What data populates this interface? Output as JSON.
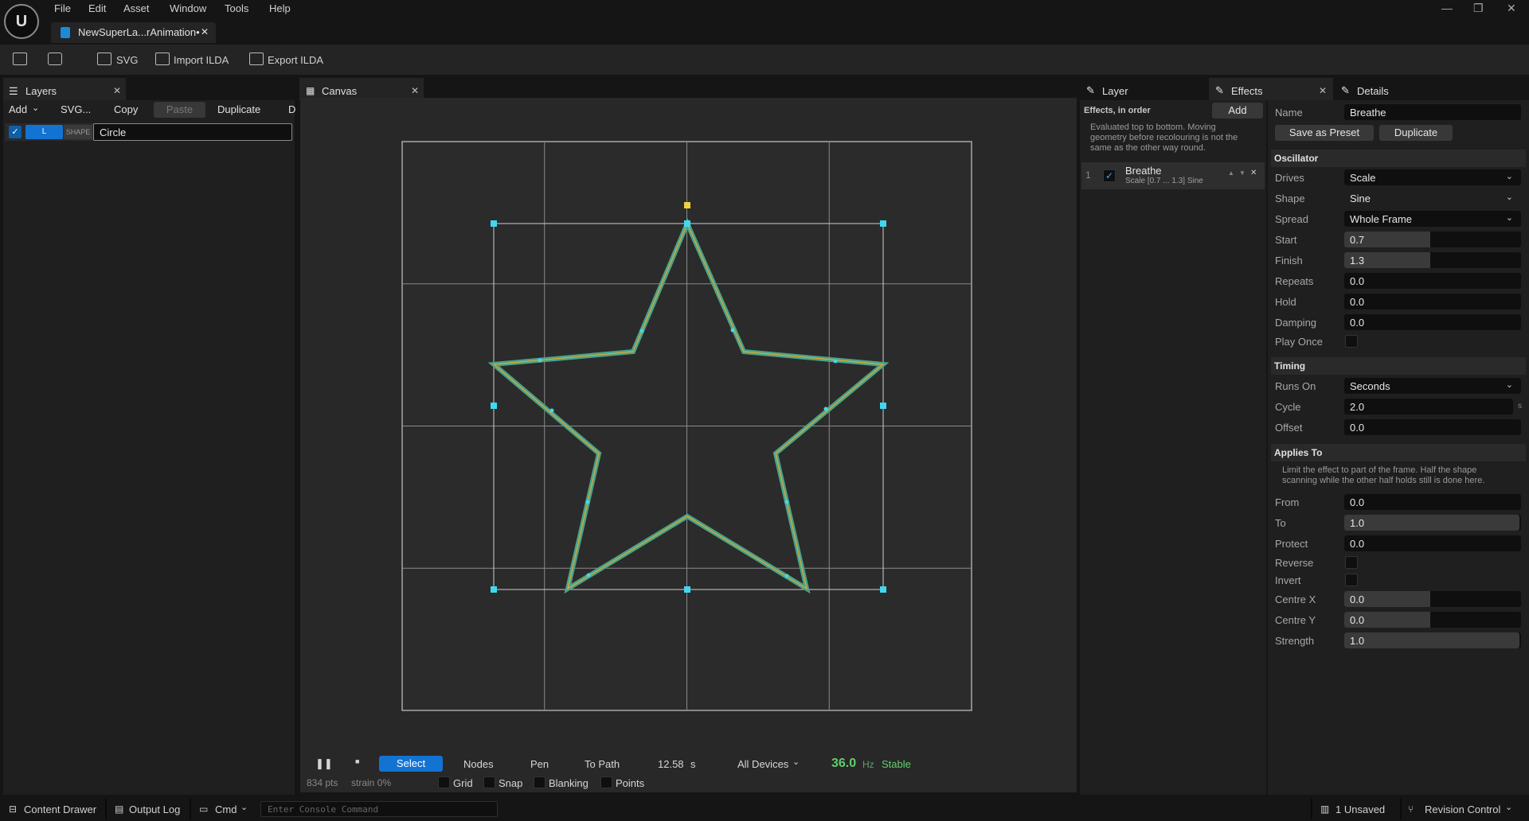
{
  "app": {
    "logo": "U",
    "doc_tab": "NewSuperLa...rAnimation•"
  },
  "menu": [
    "File",
    "Edit",
    "Asset",
    "Window",
    "Tools",
    "Help"
  ],
  "toolbar": {
    "svg": "SVG",
    "import_ilda": "Import ILDA",
    "export_ilda": "Export ILDA"
  },
  "layers": {
    "tab": "Layers",
    "add": "Add",
    "svg": "SVG...",
    "copy": "Copy",
    "paste": "Paste",
    "duplicate": "Duplicate",
    "more": "D",
    "row": {
      "badge": "L",
      "type": "SHAPE",
      "name": "Circle"
    }
  },
  "canvas": {
    "tab": "Canvas",
    "select": "Select",
    "nodes": "Nodes",
    "pen": "Pen",
    "to_path": "To Path",
    "time": "12.58",
    "time_unit": "s",
    "devices": "All Devices",
    "hz_value": "36.0",
    "hz_unit": "Hz",
    "stable": "Stable",
    "pts": "834 pts",
    "strain": "strain 0%",
    "grid": "Grid",
    "snap": "Snap",
    "blanking": "Blanking",
    "points": "Points",
    "colors": {
      "stroke_outer": "#4aa38a",
      "stroke_inner": "#e0a830",
      "handle": "#40d8f0",
      "pivot": "#f0d040"
    }
  },
  "effects": {
    "tab_layer": "Layer",
    "tab_effects": "Effects",
    "tab_details": "Details",
    "header": "Effects, in order",
    "add": "Add",
    "note": [
      "Evaluated top to bottom. Moving",
      "geometry before recolouring is not the",
      "same as the other way round."
    ],
    "item": {
      "index": "1",
      "name": "Breathe",
      "desc": "Scale  [0.7 ... 1.3]  Sine"
    }
  },
  "details": {
    "name_label": "Name",
    "name_value": "Breathe",
    "save_preset": "Save as Preset",
    "duplicate": "Duplicate",
    "oscillator": "Oscillator",
    "drives_label": "Drives",
    "drives_value": "Scale",
    "shape_label": "Shape",
    "shape_value": "Sine",
    "spread_label": "Spread",
    "spread_value": "Whole Frame",
    "start_label": "Start",
    "start_value": "0.7",
    "finish_label": "Finish",
    "finish_value": "1.3",
    "repeats_label": "Repeats",
    "repeats_value": "0.0",
    "hold_label": "Hold",
    "hold_value": "0.0",
    "damping_label": "Damping",
    "damping_value": "0.0",
    "play_once_label": "Play Once",
    "timing": "Timing",
    "runs_on_label": "Runs On",
    "runs_on_value": "Seconds",
    "cycle_label": "Cycle",
    "cycle_value": "2.0",
    "cycle_unit": "s",
    "offset_label": "Offset",
    "offset_value": "0.0",
    "applies_to": "Applies To",
    "applies_note": [
      "Limit the effect to part of the frame. Half the shape",
      "scanning while the other half holds still is done here."
    ],
    "from_label": "From",
    "from_value": "0.0",
    "to_label": "To",
    "to_value": "1.0",
    "protect_label": "Protect",
    "protect_value": "0.0",
    "reverse_label": "Reverse",
    "invert_label": "Invert",
    "centre_x_label": "Centre X",
    "centre_x_value": "0.0",
    "centre_y_label": "Centre Y",
    "centre_y_value": "0.0",
    "strength_label": "Strength",
    "strength_value": "1.0"
  },
  "statusbar": {
    "content_drawer": "Content Drawer",
    "output_log": "Output Log",
    "cmd": "Cmd",
    "console_placeholder": "Enter Console Command",
    "unsaved": "1 Unsaved",
    "revision_control": "Revision Control"
  }
}
